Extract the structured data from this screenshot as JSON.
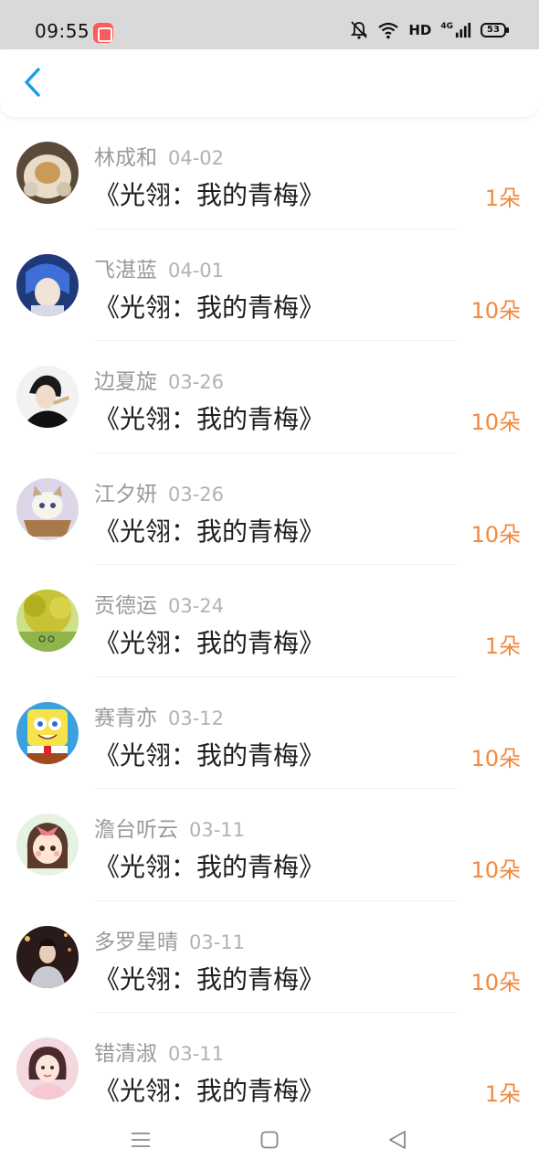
{
  "status_bar": {
    "time": "09:55",
    "network": "HD",
    "signal": "4G",
    "battery": "53"
  },
  "header": {
    "back_icon": "chevron-left-icon"
  },
  "list": [
    {
      "name": "林成和",
      "date": "04-02",
      "title": "《光翎：我的青梅》",
      "count": "1朵"
    },
    {
      "name": "飞湛蓝",
      "date": "04-01",
      "title": "《光翎：我的青梅》",
      "count": "10朵"
    },
    {
      "name": "边夏旋",
      "date": "03-26",
      "title": "《光翎：我的青梅》",
      "count": "10朵"
    },
    {
      "name": "江夕妍",
      "date": "03-26",
      "title": "《光翎：我的青梅》",
      "count": "10朵"
    },
    {
      "name": "贡德运",
      "date": "03-24",
      "title": "《光翎：我的青梅》",
      "count": "1朵"
    },
    {
      "name": "赛青亦",
      "date": "03-12",
      "title": "《光翎：我的青梅》",
      "count": "10朵"
    },
    {
      "name": "澹台听云",
      "date": "03-11",
      "title": "《光翎：我的青梅》",
      "count": "10朵"
    },
    {
      "name": "多罗星晴",
      "date": "03-11",
      "title": "《光翎：我的青梅》",
      "count": "10朵"
    },
    {
      "name": "错清淑",
      "date": "03-11",
      "title": "《光翎：我的青梅》",
      "count": "1朵"
    }
  ],
  "colors": {
    "accent": "#1a9be6",
    "count": "#f08a3e"
  }
}
